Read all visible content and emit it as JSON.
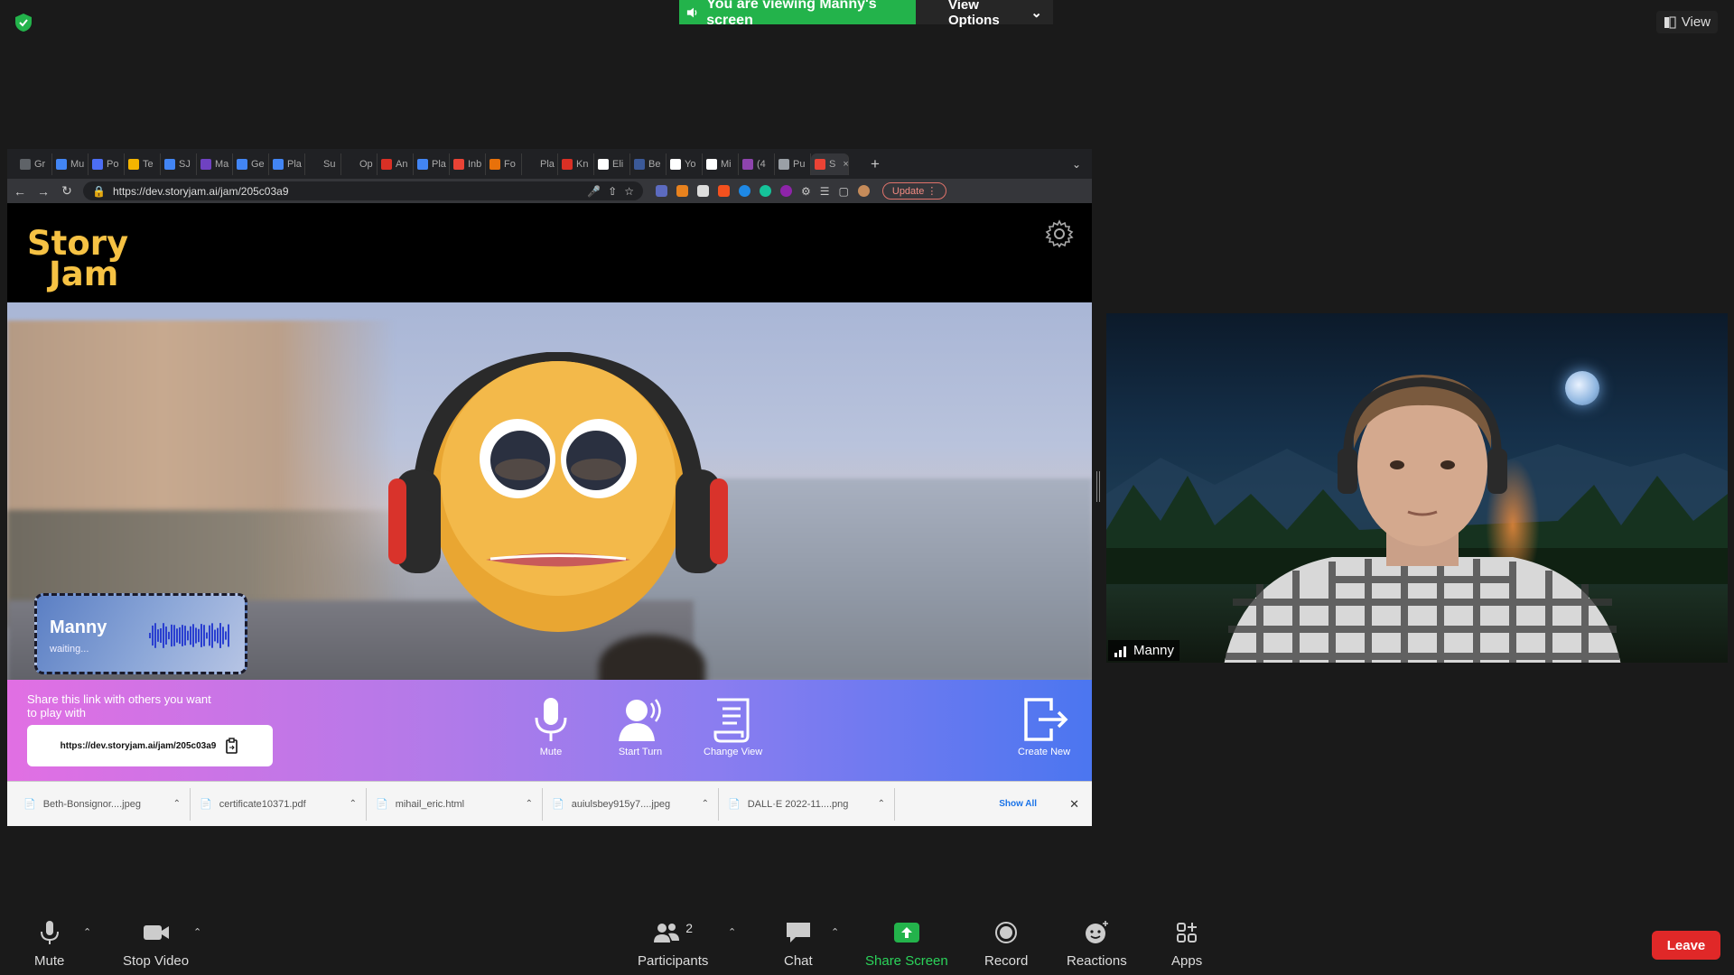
{
  "banner": {
    "viewing": "You are viewing Manny's screen",
    "options": "View Options",
    "view": "View"
  },
  "browser": {
    "tabs": [
      {
        "label": "Gr",
        "color": "#5f6368"
      },
      {
        "label": "Mu",
        "color": "#4285f4"
      },
      {
        "label": "Po",
        "color": "#4c6ef5"
      },
      {
        "label": "Te",
        "color": "#f4b400"
      },
      {
        "label": "SJ",
        "color": "#4285f4"
      },
      {
        "label": "Ma",
        "color": "#6f42c1"
      },
      {
        "label": "Ge",
        "color": "#4285f4"
      },
      {
        "label": "Pla",
        "color": "#4285f4"
      },
      {
        "label": "Su",
        "color": "#202124"
      },
      {
        "label": "Op",
        "color": "#202124"
      },
      {
        "label": "An",
        "color": "#d93025"
      },
      {
        "label": "Pla",
        "color": "#4285f4"
      },
      {
        "label": "Inb",
        "color": "#ea4335"
      },
      {
        "label": "Fo",
        "color": "#e8710a"
      },
      {
        "label": "Pla",
        "color": "#202124"
      },
      {
        "label": "Kn",
        "color": "#d93025"
      },
      {
        "label": "Eli",
        "color": "#ffffff"
      },
      {
        "label": "Be",
        "color": "#3b5998"
      },
      {
        "label": "Yo",
        "color": "#ffffff"
      },
      {
        "label": "Mi",
        "color": "#ffffff"
      },
      {
        "label": "(4",
        "color": "#8e44ad"
      },
      {
        "label": "Pu",
        "color": "#9aa0a6"
      },
      {
        "label": "S",
        "color": "#ea4335"
      }
    ],
    "url": "https://dev.storyjam.ai/jam/205c03a9",
    "update": "Update"
  },
  "storyjam": {
    "logo_line1": "Story",
    "logo_line2": "Jam",
    "player": {
      "name": "Manny",
      "status": "waiting..."
    },
    "share_text": "Share this link with others you want to play with",
    "share_link": "https://dev.storyjam.ai/jam/205c03a9",
    "tools": {
      "mute": "Mute",
      "start_turn": "Start Turn",
      "change_view": "Change View",
      "create_new": "Create New"
    }
  },
  "downloads": {
    "items": [
      "Beth-Bonsignor....jpeg",
      "certificate10371.pdf",
      "mihail_eric.html",
      "auiulsbey915y7....jpeg",
      "DALL·E 2022-11....png"
    ],
    "show_all": "Show All"
  },
  "video": {
    "name": "Manny"
  },
  "zoom": {
    "mute": "Mute",
    "stop_video": "Stop Video",
    "participants": "Participants",
    "participant_count": "2",
    "chat": "Chat",
    "share_screen": "Share Screen",
    "record": "Record",
    "reactions": "Reactions",
    "apps": "Apps",
    "leave": "Leave"
  },
  "colors": {
    "green": "#23b34b",
    "leave": "#e02828",
    "logo": "#f6c244"
  }
}
